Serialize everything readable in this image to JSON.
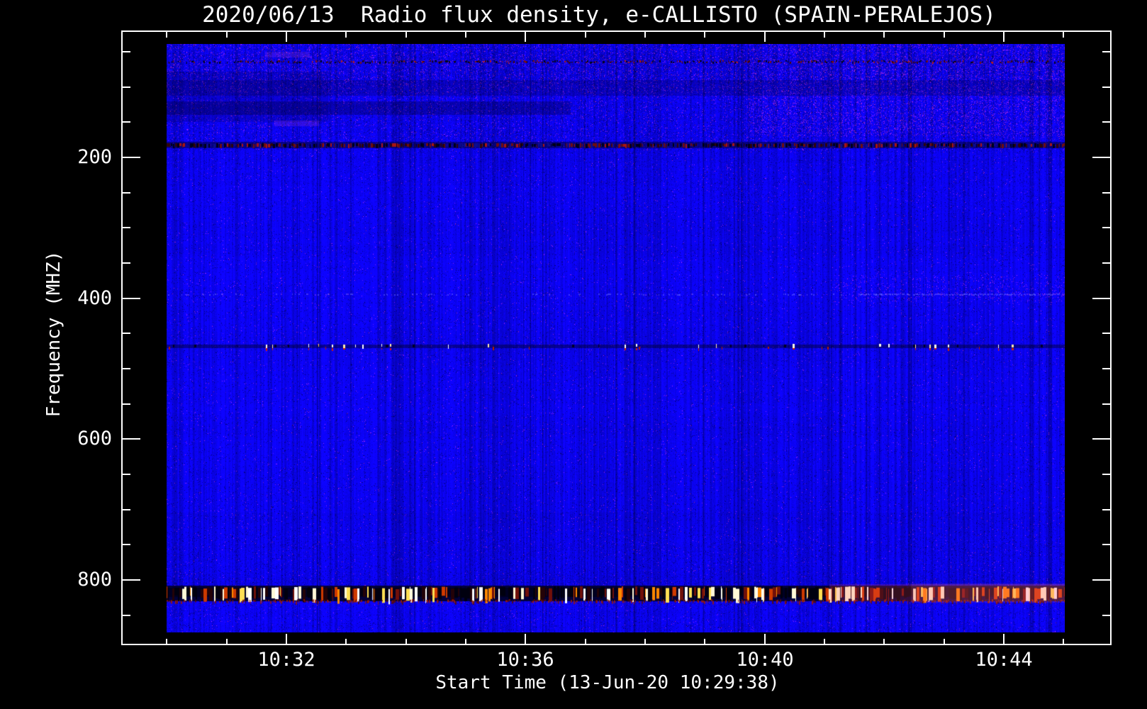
{
  "title": "2020/06/13  Radio flux density, e-CALLISTO (SPAIN-PERALEJOS)",
  "axes": {
    "x": {
      "label": "Start Time (13-Jun-20 10:29:38)",
      "tick_labels": [
        "10:32",
        "10:36",
        "10:40",
        "10:44"
      ]
    },
    "y": {
      "label": "Frequency (MHZ)",
      "tick_labels": [
        "200",
        "400",
        "600",
        "800"
      ]
    }
  },
  "colors": {
    "page_background": "#000000",
    "frame": "#ffffff",
    "text": "#ffffff",
    "quiet_blue": "#1407e8"
  },
  "chart_data": {
    "type": "heatmap",
    "subtype": "radio-spectrogram",
    "title": "2020/06/13  Radio flux density, e-CALLISTO (SPAIN-PERALEJOS)",
    "xlabel": "Start Time (13-Jun-20 10:29:38)",
    "ylabel": "Frequency (MHZ)",
    "x_tick_labels": [
      "10:32",
      "10:36",
      "10:40",
      "10:44"
    ],
    "x_minor_tick_interval_minutes": 1,
    "y_tick_values_mhz": [
      200,
      400,
      600,
      800
    ],
    "y_minor_tick_interval_mhz": 50,
    "y_axis_range_mhz": [
      20,
      893
    ],
    "y_axis_inverted": true,
    "data_area_freq_range_mhz": [
      39,
      875
    ],
    "observation_start": "13-Jun-20 10:29:38",
    "grid": false,
    "legend_position": "none",
    "palette": {
      "quiet": "#1407e8",
      "dark_rfi": "#000018",
      "red_rfi": "#d12a00",
      "orange_rfi": "#ff8a00",
      "yellow_rfi": "#ffe84f",
      "saturated_rfi": "#ffffff"
    },
    "rfi_bands": [
      {
        "freq_mhz": 64,
        "kind": "dotted-dark",
        "description": "thin dotted dark/red interference line across full time range"
      },
      {
        "freq_mhz": 181,
        "kind": "dashed-dark",
        "description": "strong dark dashed interference band across full time range"
      },
      {
        "freq_mhz": 394,
        "kind": "faint-light",
        "description": "faint lighter/pinkish line, strongest near end of record"
      },
      {
        "freq_mhz": 469,
        "kind": "bright-sparse",
        "description": "intermittent saturated white/yellow bursts with red tails"
      },
      {
        "freq_mhz": 819,
        "kind": "strong-mixed",
        "description": "intense RFI band: dense white/yellow/orange/red dashes on dark strip, reddish toward end"
      }
    ],
    "shade_patches": [
      {
        "freq_mhz": [
          90,
          112
        ],
        "x_frac": [
          0,
          1
        ],
        "strength": 0.1
      },
      {
        "freq_mhz": [
          120,
          140
        ],
        "x_frac": [
          0,
          0.45
        ],
        "strength": 0.14
      },
      {
        "freq_mhz": [
          78,
          150
        ],
        "x_frac": [
          0,
          0.18
        ],
        "strength": 0.08
      }
    ],
    "pink_patches": [
      {
        "freq_mhz": 54,
        "x_frac": [
          0.11,
          0.16
        ]
      },
      {
        "freq_mhz": 152,
        "x_frac": [
          0.12,
          0.17
        ]
      }
    ]
  }
}
